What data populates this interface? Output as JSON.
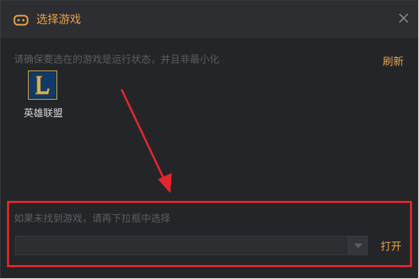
{
  "window": {
    "title": "选择游戏",
    "close_icon": "close-icon",
    "app_icon": "gamepad-icon"
  },
  "main": {
    "hint": "请确保要选在的游戏是运行状态，并且非最小化",
    "refresh_label": "刷新",
    "games": [
      {
        "name": "英雄联盟",
        "icon": "league-of-legends-logo"
      }
    ]
  },
  "fallback": {
    "label": "如果未找到游戏，请再下拉框中选择",
    "select_value": "",
    "open_label": "打开"
  },
  "colors": {
    "accent": "#e6a24c",
    "background": "#242528",
    "titlebar": "#2d2e32",
    "annotation": "#e3262b"
  }
}
